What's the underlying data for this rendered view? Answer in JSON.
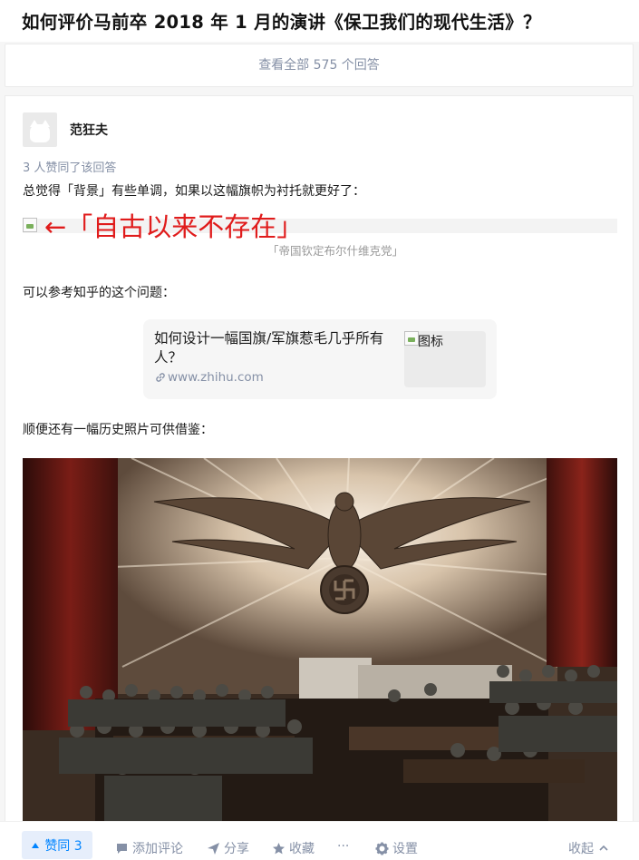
{
  "question": {
    "title": "如何评价马前卒 2018 年 1 月的演讲《保卫我们的现代生活》？",
    "view_all": "查看全部 575 个回答"
  },
  "answer": {
    "author_name": "范狂夫",
    "votes_text": "3 人赞同了该回答",
    "paragraph_1": "总觉得「背景」有些单调，如果以这幅旗帜为衬托就更好了：",
    "annotation": "←「自古以来不存在」",
    "flag_caption": "「帝国钦定布尔什维克党」",
    "paragraph_2": "可以参考知乎的这个问题：",
    "link_card": {
      "title": "如何设计一幅国旗/军旗惹毛几乎所有人？",
      "domain": "www.zhihu.com",
      "thumb_alt": "图标"
    },
    "paragraph_3": "顺便还有一幅历史照片可供借鉴："
  },
  "actions": {
    "vote_label": "赞同 3",
    "comment_label": "添加评论",
    "share_label": "分享",
    "favorite_label": "收藏",
    "more_label": "···",
    "settings_label": "设置",
    "collapse_label": "收起"
  },
  "colors": {
    "accent": "#0084ff",
    "annotation_red": "#e01c1c",
    "muted": "#8590a6"
  }
}
